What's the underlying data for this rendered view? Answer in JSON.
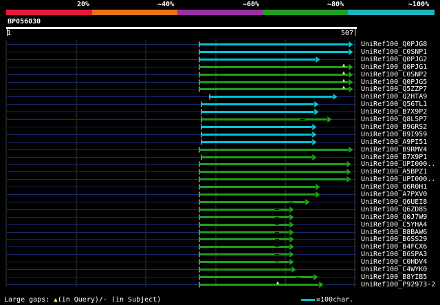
{
  "query": {
    "id": "BP056030",
    "start": "1",
    "end": "507"
  },
  "scale": {
    "labels": [
      "20%",
      "~40%",
      "~60%",
      "~80%",
      "~100%"
    ],
    "colors": [
      "#e8183a",
      "#e87318",
      "#9c2fa6",
      "#1ea01e",
      "#1eb4bf"
    ]
  },
  "hits": [
    {
      "label": "UniRef100_Q0PJG8",
      "color": "#00c6d8",
      "gaps": []
    },
    {
      "label": "UniRef100_C0SNP1",
      "color": "#00c6d8",
      "gaps": []
    },
    {
      "label": "UniRef100_Q0PJG2",
      "color": "#00c6d8",
      "gaps": []
    },
    {
      "label": "UniRef100_Q0PJG1",
      "color": "#1ea01e",
      "gaps": [
        {
          "type": "query"
        }
      ]
    },
    {
      "label": "UniRef100_C0SNP2",
      "color": "#1ea01e",
      "gaps": [
        {
          "type": "query"
        }
      ]
    },
    {
      "label": "UniRef100_Q0PJG5",
      "color": "#1ea01e",
      "gaps": [
        {
          "type": "query"
        }
      ]
    },
    {
      "label": "UniRef100_Q5ZZP7",
      "color": "#1ea01e",
      "gaps": [
        {
          "type": "query"
        }
      ]
    },
    {
      "label": "UniRef100_Q2HTA9",
      "color": "#00c6d8",
      "gaps": []
    },
    {
      "label": "UniRef100_Q56TL1",
      "color": "#00c6d8",
      "gaps": []
    },
    {
      "label": "UniRef100_B7X9P2",
      "color": "#00c6d8",
      "gaps": []
    },
    {
      "label": "UniRef100_Q8L5P7",
      "color": "#1ea01e",
      "gaps": [
        {
          "type": "subject"
        }
      ]
    },
    {
      "label": "UniRef100_B9GRS2",
      "color": "#00c6d8",
      "gaps": []
    },
    {
      "label": "UniRef100_B9I959",
      "color": "#00c6d8",
      "gaps": []
    },
    {
      "label": "UniRef100_A9PI51",
      "color": "#00c6d8",
      "gaps": []
    },
    {
      "label": "UniRef100_B9RMV4",
      "color": "#1ea01e",
      "gaps": []
    },
    {
      "label": "UniRef100_B7X9P1",
      "color": "#1ea01e",
      "gaps": []
    },
    {
      "label": "UniRef100_UPI000..",
      "color": "#1ea01e",
      "gaps": []
    },
    {
      "label": "UniRef100_A5BPZ1",
      "color": "#1ea01e",
      "gaps": []
    },
    {
      "label": "UniRef100_UPI000..",
      "color": "#1ea01e",
      "gaps": []
    },
    {
      "label": "UniRef100_Q6R0H1",
      "color": "#1ea01e",
      "gaps": []
    },
    {
      "label": "UniRef100_A7PXV0",
      "color": "#1ea01e",
      "gaps": []
    },
    {
      "label": "UniRef100_Q6UEI8",
      "color": "#1ea01e",
      "gaps": [
        {
          "type": "subject"
        }
      ]
    },
    {
      "label": "UniRef100_Q6ZD85",
      "color": "#1ea01e",
      "gaps": [
        {
          "type": "subject"
        }
      ]
    },
    {
      "label": "UniRef100_Q0J7W9",
      "color": "#1ea01e",
      "gaps": [
        {
          "type": "subject"
        }
      ]
    },
    {
      "label": "UniRef100_C5YHA4",
      "color": "#1ea01e",
      "gaps": [
        {
          "type": "subject"
        }
      ]
    },
    {
      "label": "UniRef100_B8BAW6",
      "color": "#1ea01e",
      "gaps": [
        {
          "type": "subject"
        }
      ]
    },
    {
      "label": "UniRef100_B6SS29",
      "color": "#1ea01e",
      "gaps": [
        {
          "type": "subject"
        }
      ]
    },
    {
      "label": "UniRef100_B4FCX6",
      "color": "#1ea01e",
      "gaps": [
        {
          "type": "subject"
        }
      ]
    },
    {
      "label": "UniRef100_B6SPA3",
      "color": "#1ea01e",
      "gaps": [
        {
          "type": "subject"
        }
      ]
    },
    {
      "label": "UniRef100_C0HDV4",
      "color": "#1ea01e",
      "gaps": [
        {
          "type": "subject"
        }
      ]
    },
    {
      "label": "UniRef100_C4WYK0",
      "color": "#1ea01e",
      "gaps": []
    },
    {
      "label": "UniRef100_B8YIB5",
      "color": "#1ea01e",
      "gaps": [
        {
          "type": "subject"
        }
      ]
    },
    {
      "label": "UniRef100_P92973-2",
      "color": "#1ea01e",
      "gaps": [
        {
          "type": "query"
        }
      ]
    }
  ],
  "footer": {
    "legend_prefix": "Large gaps:",
    "legend_query": "(in Query)/",
    "legend_subject": "- (in Subject)",
    "scale_label": "=100char."
  }
}
